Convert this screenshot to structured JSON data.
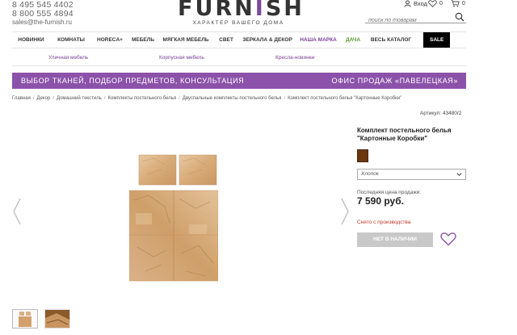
{
  "header": {
    "phone1": "8 495 545 4402",
    "phone2": "8 800 555 4894",
    "email": "sales@the-furnish.ru",
    "logo_left": "FURN",
    "logo_mark": "I",
    "logo_right": "SH",
    "tagline": "ХАРАКТЕР ВАШЕГО ДОМА",
    "login_label": "Вход",
    "wishlist_count": "0",
    "cart_count": "0",
    "search_placeholder": "поиск по товарам"
  },
  "nav": {
    "items": [
      {
        "label": "НОВИНКИ",
        "style": "normal"
      },
      {
        "label": "КОМНАТЫ",
        "style": "normal"
      },
      {
        "label": "HORECA+",
        "style": "normal"
      },
      {
        "label": "МЕБЕЛЬ",
        "style": "normal"
      },
      {
        "label": "МЯГКАЯ МЕБЕЛЬ",
        "style": "normal"
      },
      {
        "label": "СВЕТ",
        "style": "normal"
      },
      {
        "label": "ЗЕРКАЛА & ДЕКОР",
        "style": "normal"
      },
      {
        "label": "НАША МАРКА",
        "style": "purple"
      },
      {
        "label": "ДАЧА",
        "style": "green"
      },
      {
        "label": "ВЕСЬ КАТАЛОГ",
        "style": "normal"
      },
      {
        "label": "SALE",
        "style": "sale"
      }
    ],
    "sub_items": [
      "Уличная мебель",
      "Корпусная мебель",
      "Кресла-новинки"
    ]
  },
  "banner": {
    "left": "ВЫБОР ТКАНЕЙ, ПОДБОР ПРЕДМЕТОВ, КОНСУЛЬТАЦИЯ",
    "right": "ОФИС ПРОДАЖ «ПАВЕЛЕЦКАЯ»",
    "color": "#8c52a9"
  },
  "breadcrumb": [
    "Главная",
    "Декор",
    "Домашний текстиль",
    "Комплекты постельного белья",
    "Двуспальные комплекты постельного белья",
    "Комплект постельного белья \"Картонные Коробки\""
  ],
  "product": {
    "article": "Артикул: 43480/2",
    "title": "Комплект постельного белья \"Картонные Коробки\"",
    "swatch_color": "#6b3710",
    "material": "Хлопок",
    "price_label": "Последняя цена продажи:",
    "price": "7 590 руб.",
    "status": "Снято с производства",
    "oos_button": "НЕТ В НАЛИЧИИ"
  },
  "gallery": {
    "prev_arrow": "‹",
    "next_arrow": "›",
    "icons": [
      "chevron-left-icon",
      "chevron-right-icon",
      "heart-icon",
      "search-icon",
      "user-icon",
      "cart-icon"
    ]
  }
}
